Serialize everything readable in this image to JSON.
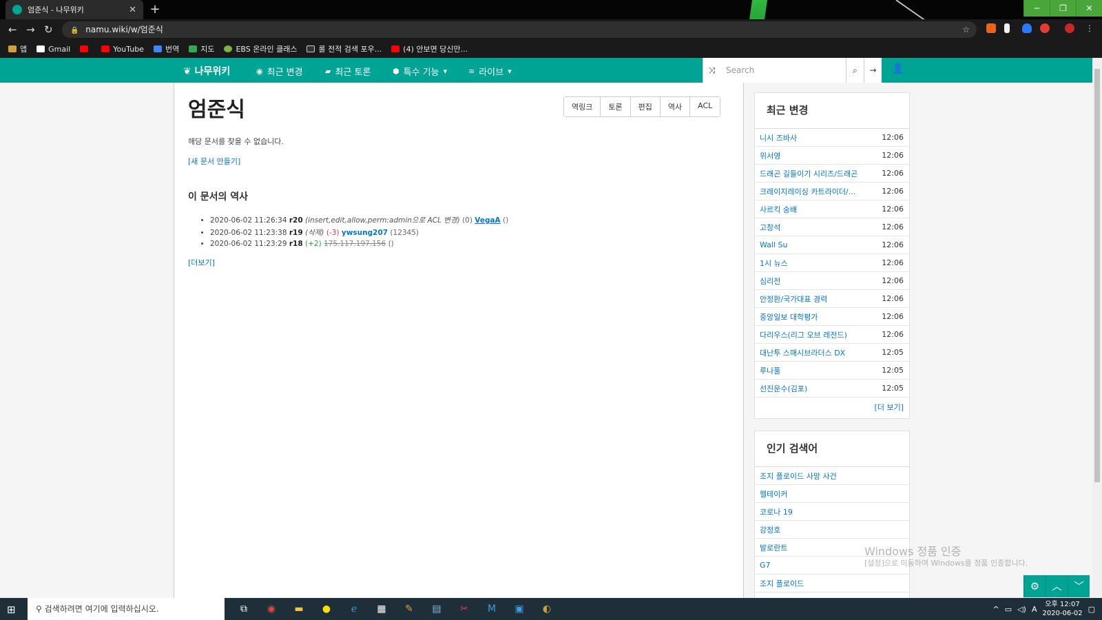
{
  "browser": {
    "tab_title": "엄준식 - 나무위키",
    "url": "namu.wiki/w/엄준식",
    "window_buttons": [
      "─",
      "❐",
      "✕"
    ],
    "bookmarks": [
      "앱",
      "Gmail",
      "",
      "YouTube",
      "번역",
      "지도",
      "EBS 온라인 클래스",
      "롤 전적 검색 포우...",
      "(4) 안보면 당신만..."
    ]
  },
  "navbar": {
    "logo": "나무위키",
    "items": [
      "최근 변경",
      "최근 토론",
      "특수 기능",
      "라이브"
    ],
    "search_placeholder": "Search"
  },
  "article": {
    "title": "엄준식",
    "actions": [
      "역링크",
      "토론",
      "편집",
      "역사",
      "ACL"
    ],
    "notfound": "해당 문서를 찾을 수 없습니다.",
    "newdoc": "[새 문서 만들기]",
    "history_heading": "이 문서의 역사",
    "history": [
      {
        "date": "2020-06-02 11:26:34",
        "rev": "r20",
        "note": "(insert,edit,allow,perm:admin으로 ACL 변경)",
        "delta": "(0)",
        "user": "VegaA",
        "comment": "()"
      },
      {
        "date": "2020-06-02 11:23:38",
        "rev": "r19",
        "note": "(삭제)",
        "delta": "(-3)",
        "user": "ywsung207",
        "comment": "(12345)"
      },
      {
        "date": "2020-06-02 11:23:29",
        "rev": "r18",
        "note": "",
        "delta": "(+2)",
        "user": "175.117.197.156",
        "comment": "()"
      }
    ],
    "more": "[더보기]"
  },
  "sidebar": {
    "recent_heading": "최근 변경",
    "recent": [
      {
        "label": "니시 즈바사",
        "time": "12:06"
      },
      {
        "label": "위서영",
        "time": "12:06"
      },
      {
        "label": "드래곤 길들이기 시리즈/드래곤",
        "time": "12:06"
      },
      {
        "label": "크레이지레이싱 카트라이더/...",
        "time": "12:06"
      },
      {
        "label": "사르킥 숭배",
        "time": "12:06"
      },
      {
        "label": "고창석",
        "time": "12:06"
      },
      {
        "label": "Wall Su",
        "time": "12:06"
      },
      {
        "label": "1시 뉴스",
        "time": "12:06"
      },
      {
        "label": "심리전",
        "time": "12:06"
      },
      {
        "label": "안정환/국가대표 경력",
        "time": "12:06"
      },
      {
        "label": "중앙일보 대학평가",
        "time": "12:06"
      },
      {
        "label": "다리우스(리그 오브 레전드)",
        "time": "12:06"
      },
      {
        "label": "대난투 스매시브라더스 DX",
        "time": "12:05"
      },
      {
        "label": "루나풀",
        "time": "12:05"
      },
      {
        "label": "선진운수(김포)",
        "time": "12:05"
      }
    ],
    "recent_more": "[더 보기]",
    "popular_heading": "인기 검색어",
    "popular": [
      "조지 플로이드 사망 사건",
      "헬테이커",
      "코로나 19",
      "강정호",
      "발로란트",
      "G7",
      "조지 플로이드"
    ]
  },
  "watermark": {
    "line1": "Windows 정품 인증",
    "line2": "[설정]으로 이동하여 Windows를 정품 인증합니다."
  },
  "taskbar": {
    "search_placeholder": "검색하려면 여기에 입력하십시오.",
    "time": "오후 12:07",
    "date": "2020-06-02",
    "ime": "A"
  }
}
